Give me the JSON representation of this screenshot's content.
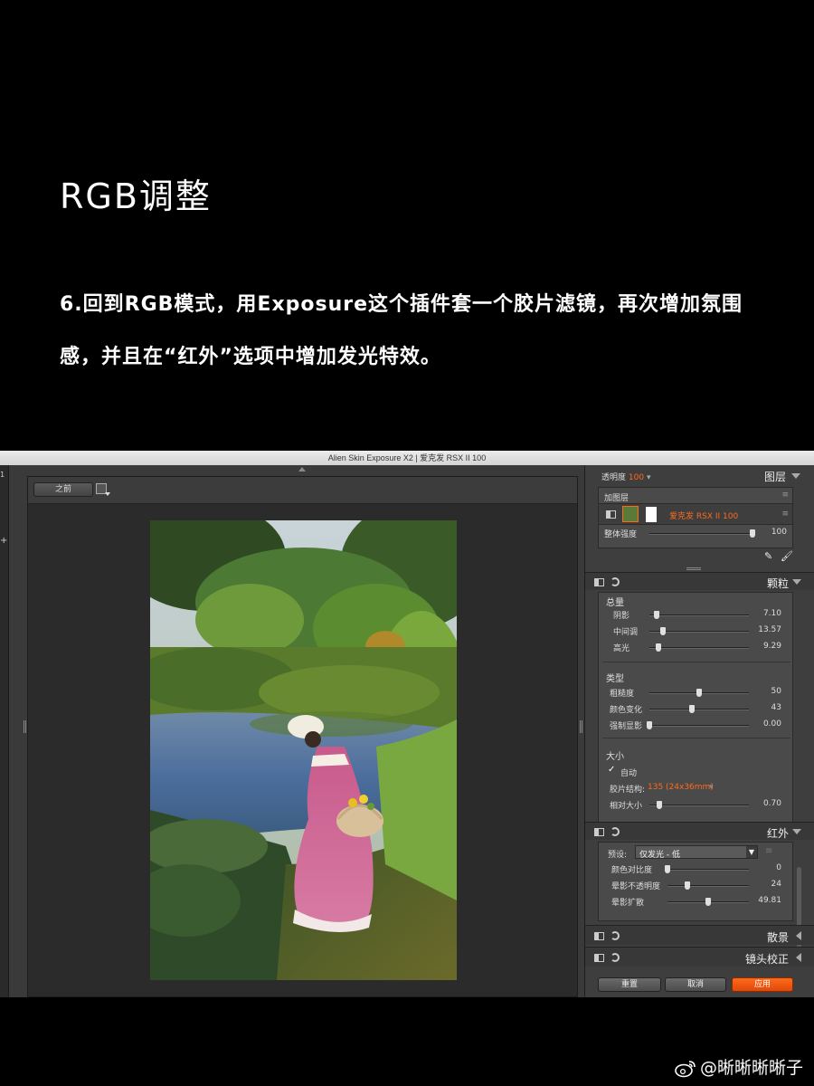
{
  "heading": "RGB调整",
  "paragraph": "6.回到RGB模式，用Exposure这个插件套一个胶片滤镜，再次增加氛围感，并且在“红外”选项中增加发光特效。",
  "window": {
    "title": "Alien Skin Exposure X2 | 爱克发 RSX II 100",
    "left_strip_num": "1",
    "left_strip_plus": "+"
  },
  "preview": {
    "before_label": "之前"
  },
  "layers": {
    "opacity_label": "透明度",
    "opacity_value": "100",
    "section_title": "图层",
    "add_layer_label": "加图层",
    "layer_name": "爱克发 RSX II 100",
    "overall_strength_label": "整体强度",
    "overall_strength_value": "100",
    "overall_strength_level": 100
  },
  "grain": {
    "section_title": "颗粒",
    "amount_group": "总量",
    "amount": [
      {
        "label": "阴影",
        "value": "7.10",
        "level": 0.07
      },
      {
        "label": "中间调",
        "value": "13.57",
        "level": 0.14
      },
      {
        "label": "高光",
        "value": "9.29",
        "level": 0.09
      }
    ],
    "type_group": "类型",
    "type": [
      {
        "label": "粗糙度",
        "value": "50",
        "level": 0.5
      },
      {
        "label": "颜色变化",
        "value": "43",
        "level": 0.43
      },
      {
        "label": "强制显影",
        "value": "0.00",
        "level": 0.0
      }
    ],
    "size_group": "大小",
    "auto_label": "自动",
    "film_structure_label": "胶片结构:",
    "film_structure_value": "135 (24x36mm)",
    "relative_size_label": "相对大小",
    "relative_size_value": "0.70",
    "relative_size_level": 0.1
  },
  "infrared": {
    "section_title": "红外",
    "preset_label": "预设:",
    "preset_value": "仅发光 - 低",
    "sliders": [
      {
        "label": "颜色对比度",
        "value": "0",
        "level": 0.0
      },
      {
        "label": "晕影不透明度",
        "value": "24",
        "level": 0.24
      },
      {
        "label": "晕影扩散",
        "value": "49.81",
        "level": 0.5
      }
    ]
  },
  "collapsed_sections": [
    "散景",
    "镜头校正"
  ],
  "buttons": {
    "reset": "重置",
    "cancel": "取消",
    "apply": "应用"
  },
  "watermark": "@晰晰晰晰子",
  "colors": {
    "accent": "#ff6a1a",
    "panel_bg": "#3e3e3e",
    "background": "#000000"
  }
}
